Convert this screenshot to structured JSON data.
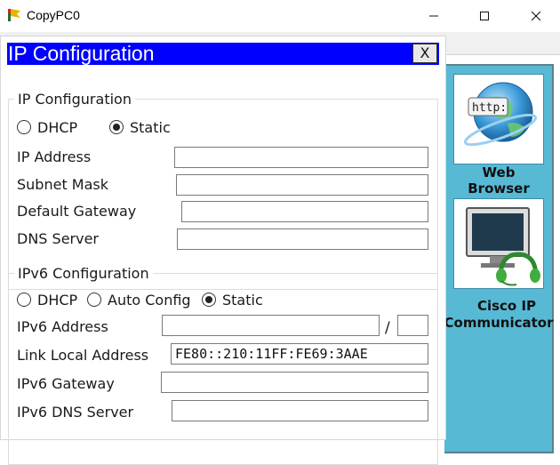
{
  "window": {
    "title": "CopyPC0",
    "minimize_glyph": "—",
    "maximize_glyph": "☐",
    "close_glyph": "✕"
  },
  "desktop": {
    "apps": [
      {
        "label_line1": "Web",
        "label_line2": "Browser",
        "icon": "web-browser-icon"
      },
      {
        "label_line1": "Cisco IP",
        "label_line2": "Communicator",
        "icon": "cisco-ip-communicator-icon"
      }
    ],
    "http_badge": "http:",
    "panel_color": "#57b9d4"
  },
  "ip_config": {
    "title": "IP Configuration",
    "close_label": "X",
    "title_color": "#0000ff",
    "ipv4": {
      "legend": "IP Configuration",
      "dhcp_label": "DHCP",
      "static_label": "Static",
      "selected_mode": "Static",
      "fields": {
        "ip_address": {
          "label": "IP Address",
          "value": ""
        },
        "subnet_mask": {
          "label": "Subnet Mask",
          "value": ""
        },
        "default_gateway": {
          "label": "Default Gateway",
          "value": ""
        },
        "dns_server": {
          "label": "DNS Server",
          "value": ""
        }
      }
    },
    "ipv6": {
      "legend": "IPv6 Configuration",
      "dhcp_label": "DHCP",
      "auto_config_label": "Auto Config",
      "static_label": "Static",
      "selected_mode": "Static",
      "prefix_separator": "/",
      "fields": {
        "ipv6_address": {
          "label": "IPv6 Address",
          "value": ""
        },
        "prefix_length": {
          "value": ""
        },
        "link_local_address": {
          "label": "Link Local Address",
          "value": "FE80::210:11FF:FE69:3AAE"
        },
        "ipv6_gateway": {
          "label": "IPv6 Gateway",
          "value": ""
        },
        "ipv6_dns_server": {
          "label": "IPv6 DNS Server",
          "value": ""
        }
      }
    }
  }
}
